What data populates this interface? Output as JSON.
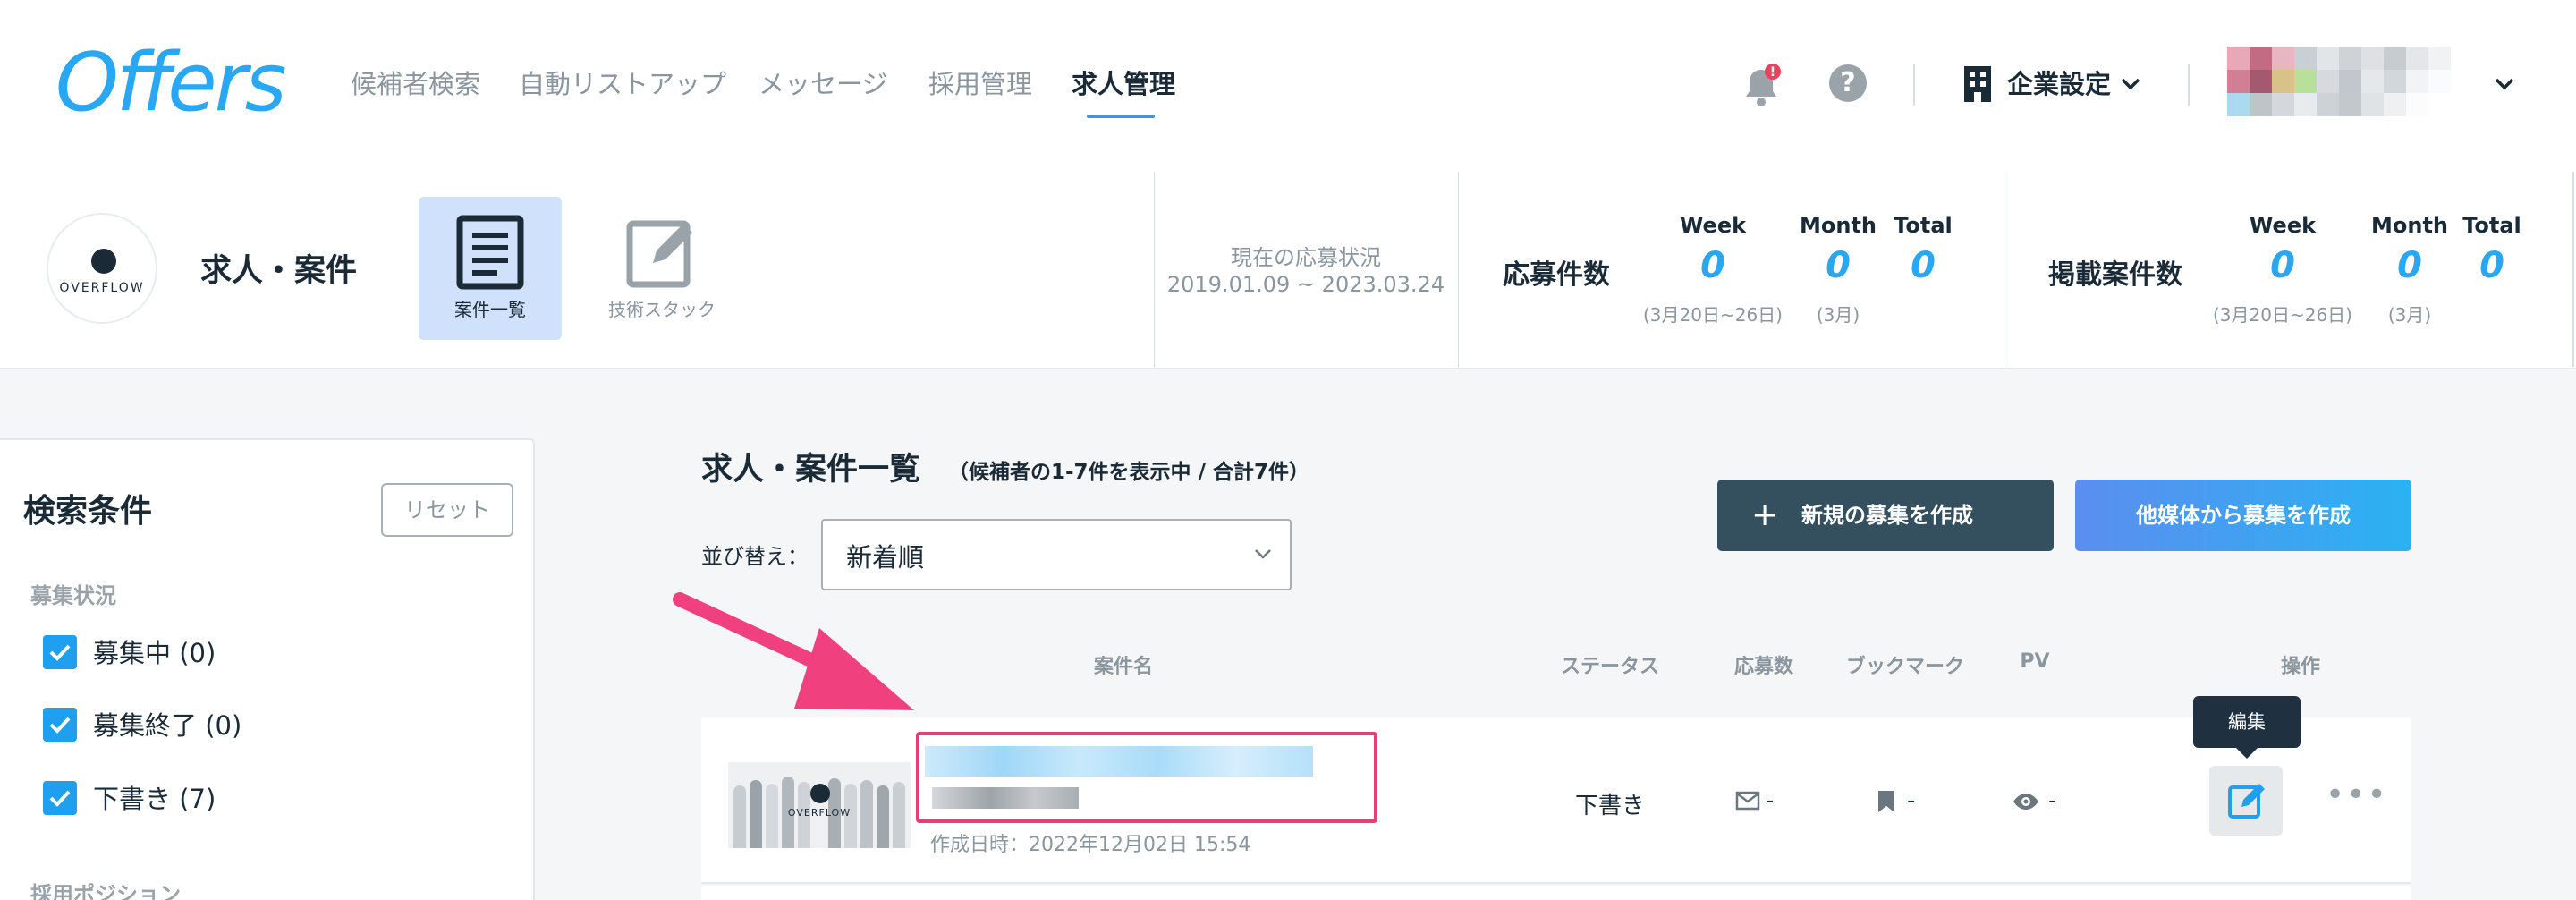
{
  "app": {
    "logo": "Offers",
    "colors": {
      "accent": "#2aa7f2",
      "highlight": "#e83e77",
      "dark_button": "#34505f"
    }
  },
  "nav": {
    "items": [
      {
        "label": "候補者検索"
      },
      {
        "label": "自動リストアップ"
      },
      {
        "label": "メッセージ"
      },
      {
        "label": "採用管理"
      },
      {
        "label": "求人管理",
        "active": true
      }
    ]
  },
  "header_right": {
    "notification_icon": "bell-icon",
    "notification_badge": "!",
    "help_icon": "?",
    "company_settings": "企業設定"
  },
  "band": {
    "company_logo_text": "OVERFLOW",
    "section_title": "求人・案件",
    "tabs": [
      {
        "label": "案件一覧",
        "icon": "document-list-icon",
        "active": true
      },
      {
        "label": "技術スタック",
        "icon": "edit-icon"
      }
    ],
    "status": {
      "label": "現在の応募状況",
      "range": "2019.01.09 ~ 2023.03.24"
    },
    "applications": {
      "title": "応募件数",
      "columns": [
        {
          "head": "Week",
          "value": "0",
          "sub": "(3月20日~26日)"
        },
        {
          "head": "Month",
          "value": "0",
          "sub": "(3月)"
        },
        {
          "head": "Total",
          "value": "0",
          "sub": ""
        }
      ]
    },
    "listings": {
      "title": "掲載案件数",
      "columns": [
        {
          "head": "Week",
          "value": "0",
          "sub": "(3月20日~26日)"
        },
        {
          "head": "Month",
          "value": "0",
          "sub": "(3月)"
        },
        {
          "head": "Total",
          "value": "0",
          "sub": ""
        }
      ]
    }
  },
  "sidebar": {
    "title": "検索条件",
    "reset": "リセット",
    "status_group": "募集状況",
    "checks": [
      {
        "label": "募集中 (0)",
        "checked": true
      },
      {
        "label": "募集終了 (0)",
        "checked": true
      },
      {
        "label": "下書き (7)",
        "checked": true
      }
    ],
    "position_group": "採用ポジション"
  },
  "main": {
    "title": "求人・案件一覧",
    "subtitle": "（候補者の1-7件を表示中 / 合計7件）",
    "sort_label": "並び替え：",
    "sort_value": "新着順",
    "create_button": "新規の募集を作成",
    "import_button": "他媒体から募集を作成",
    "columns": {
      "name": "案件名",
      "status": "ステータス",
      "applications": "応募数",
      "bookmarks": "ブックマーク",
      "pv": "PV",
      "actions": "操作"
    },
    "rows": [
      {
        "thumb_text": "OVERFLOW",
        "created": "作成日時：2022年12月02日 15:54",
        "status": "下書き",
        "applications": "-",
        "bookmarks": "-",
        "pv": "-",
        "tooltip": "編集"
      }
    ]
  }
}
